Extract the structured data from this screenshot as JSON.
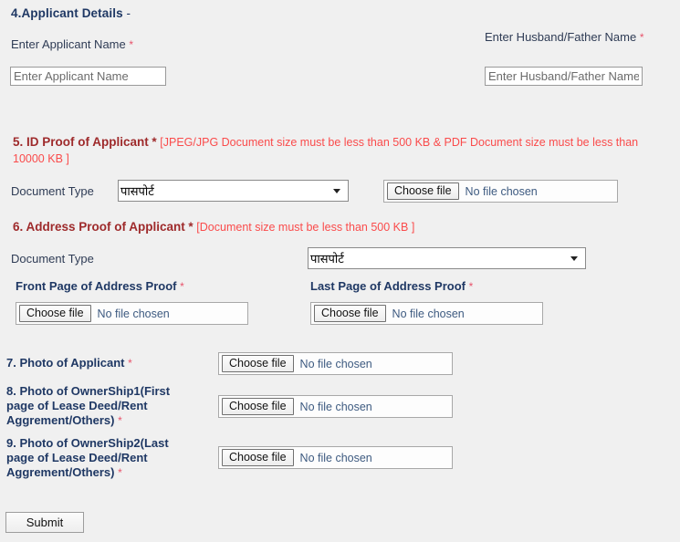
{
  "section4": {
    "title": "4.Applicant Details",
    "title_dash": " -",
    "applicant_name_label": "Enter Applicant Name",
    "applicant_name_required": "*",
    "applicant_name_placeholder": "Enter Applicant Name",
    "applicant_name_value": "",
    "husband_name_label": "Enter Husband/Father Name",
    "husband_name_required": "*",
    "husband_name_placeholder": "Enter Husband/Father Name",
    "husband_name_value": ""
  },
  "section5": {
    "heading": "5. ID Proof of Applicant",
    "required": "*",
    "note": "[JPEG/JPG Document size must be less than 500 KB & PDF Document size must be less than 10000 KB ]",
    "doctype_label": "Document Type",
    "doctype_selected": "पासपोर्ट",
    "doctype_options": [
      "पासपोर्ट"
    ],
    "file_button_label": "Choose file",
    "file_status": "No file chosen"
  },
  "section6": {
    "heading": "6. Address Proof of Applicant",
    "required": "*",
    "note": "[Document size must be less than 500 KB ]",
    "doctype_label": "Document Type",
    "doctype_selected": "पासपोर्ट",
    "doctype_options": [
      "पासपोर्ट"
    ],
    "front_label": "Front Page of Address Proof",
    "front_required": "*",
    "last_label": "Last Page of Address Proof",
    "last_required": "*",
    "front_file_button_label": "Choose file",
    "front_file_status": "No file chosen",
    "last_file_button_label": "Choose file",
    "last_file_status": "No file chosen"
  },
  "section7": {
    "heading": "7. Photo of Applicant",
    "required": "*",
    "file_button_label": "Choose file",
    "file_status": "No file chosen"
  },
  "section8": {
    "heading": "8. Photo of OwnerShip1(First page of Lease Deed/Rent Aggrement/Others)",
    "required": "*",
    "file_button_label": "Choose file",
    "file_status": "No file chosen"
  },
  "section9": {
    "heading": "9. Photo of OwnerShip2(Last page of Lease Deed/Rent Aggrement/Others)",
    "required": "*",
    "file_button_label": "Choose file",
    "file_status": "No file chosen"
  },
  "footer": {
    "submit_label": "Submit"
  },
  "colors": {
    "background": "#f0f0f0",
    "heading_navy": "#1f3864",
    "heading_maroon": "#9e2a2b",
    "note_red": "#fa4b4b",
    "required_red": "#e8536b",
    "label_slate": "#2f3c55",
    "file_status_blue": "#3d5a80"
  }
}
